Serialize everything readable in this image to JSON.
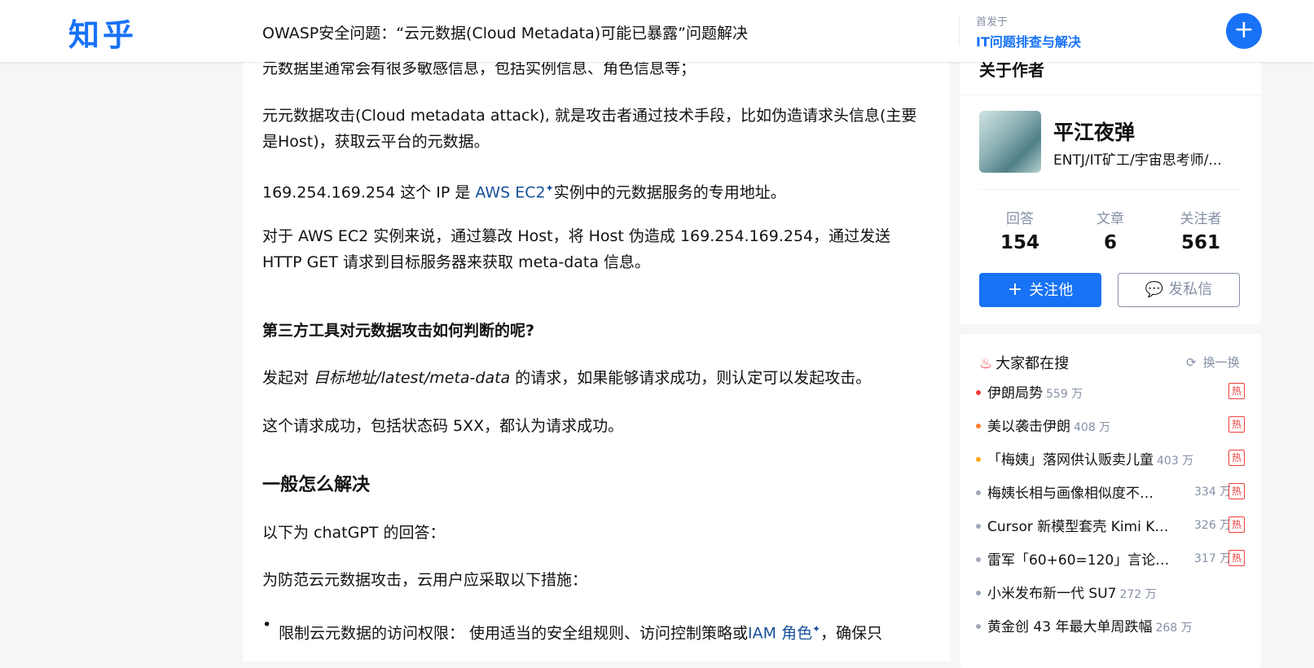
{
  "header": {
    "logo": "知乎",
    "title": "OWASP安全问题：“云元数据(Cloud Metadata)可能已暴露”问题解决",
    "published_label": "首发于",
    "column_name": "IT问题排查与解决",
    "fab_label": "+"
  },
  "article": {
    "p0": "元数据里通常会有很多敏感信息，包括实例信息、角色信息等；",
    "p1": "元元数据攻击(Cloud metadata attack), 就是攻击者通过技术手段，比如伪造请求头信息(主要是Host)，获取云平台的元数据。",
    "p2_pre": "169.254.169.254 这个 IP 是 ",
    "p2_link": "AWS EC2",
    "p2_post": "实例中的元数据服务的专用地址。",
    "p3": "对于 AWS EC2 实例来说，通过篡改 Host，将 Host 伪造成 169.254.169.254，通过发送 HTTP GET 请求到目标服务器来获取 meta-data 信息。",
    "h3": "第三方工具对元数据攻击如何判断的呢?",
    "p4_pre": "发起对 ",
    "p4_em": "目标地址/latest/meta-data",
    "p4_post": " 的请求，如果能够请求成功，则认定可以发起攻击。",
    "p5": "这个请求成功，包括状态码 5XX，都认为请求成功。",
    "h2": "一般怎么解决",
    "p6": "以下为 chatGPT 的回答：",
    "p7": "为防范云元数据攻击，云用户应采取以下措施：",
    "li1_pre": "限制云元数据的访问权限： 使用适当的安全组规则、访问控制策略或",
    "li1_link": "IAM 角色",
    "li1_post": "，确保只"
  },
  "author": {
    "section_title": "关于作者",
    "name": "平江夜弹",
    "bio": "ENTJ/IT矿工/宇宙思考师/...",
    "stats": [
      {
        "label": "回答",
        "value": "154"
      },
      {
        "label": "文章",
        "value": "6"
      },
      {
        "label": "关注者",
        "value": "561"
      }
    ],
    "follow_label": "关注他",
    "message_label": "发私信"
  },
  "hot": {
    "title": "大家都在搜",
    "refresh_label": "换一换",
    "badge": "热",
    "items": [
      {
        "title": "伊朗局势",
        "count": "559 万",
        "dot": "#f1403c"
      },
      {
        "title": "美以袭击伊朗",
        "count": "408 万",
        "dot": "#ff7e2d"
      },
      {
        "title": "「梅姨」落网供认贩卖儿童",
        "count": "403 万",
        "dot": "#ffa81e"
      },
      {
        "title": "梅姨长相与画像相似度不…",
        "count": "334 万",
        "dot": "#a0a8b8"
      },
      {
        "title": "Cursor 新模型套壳 Kimi K…",
        "count": "326 万",
        "dot": "#a0a8b8"
      },
      {
        "title": "雷军「60+60=120」言论…",
        "count": "317 万",
        "dot": "#a0a8b8"
      },
      {
        "title": "小米发布新一代 SU7",
        "count": "272 万",
        "dot": "#a0a8b8"
      },
      {
        "title": "黄金创 43 年最大单周跌幅",
        "count": "268 万",
        "dot": "#a0a8b8"
      }
    ]
  }
}
